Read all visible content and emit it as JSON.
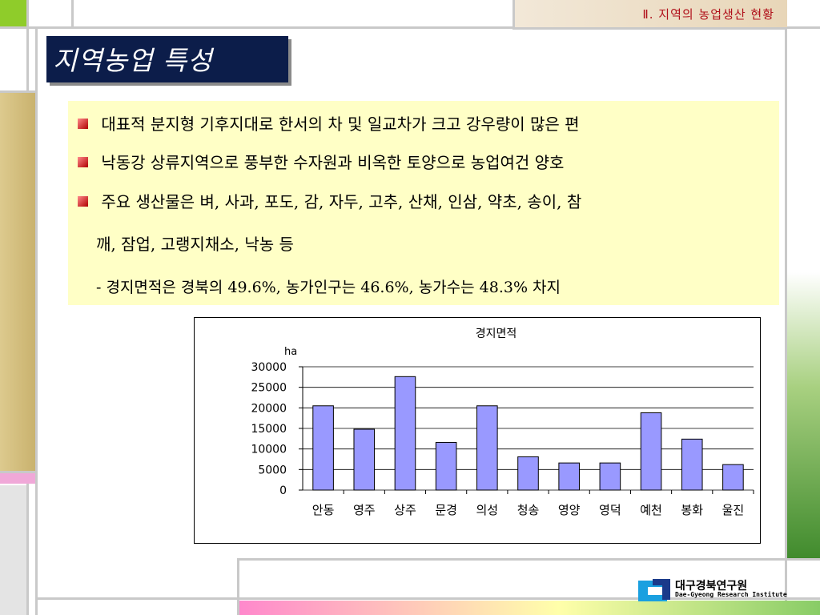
{
  "header": {
    "section_title": "Ⅱ. 지역의 농업생산 현황"
  },
  "slide": {
    "title": "지역농업 특성"
  },
  "bullets": [
    "대표적 분지형 기후지대로 한서의 차 및 일교차가 크고 강우량이 많은 편",
    "낙동강 상류지역으로 풍부한 수자원과 비옥한 토양으로 농업여건 양호",
    "주요 생산물은 벼, 사과, 포도, 감, 자두, 고추, 산채, 인삼, 약초, 송이, 참"
  ],
  "bullet_continuation": "깨, 잠업, 고랭지채소, 낙농 등",
  "sub_note": "- 경지면적은 경북의 49.6%, 농가인구는 46.6%, 농가수는 48.3% 차지",
  "chart_data": {
    "type": "bar",
    "title": "경지면적",
    "ylabel": "ha",
    "xlabel": "",
    "categories": [
      "안동",
      "영주",
      "상주",
      "문경",
      "의성",
      "청송",
      "영양",
      "영덕",
      "예천",
      "봉화",
      "울진"
    ],
    "values": [
      20500,
      14800,
      27600,
      11600,
      20500,
      8100,
      6600,
      6600,
      18800,
      12400,
      6200
    ],
    "ylim": [
      0,
      30000
    ],
    "yticks": [
      "30000",
      "25000",
      "20000",
      "15000",
      "10000",
      "5000",
      "0"
    ],
    "bar_color": "#9999ff",
    "grid": true
  },
  "footer": {
    "logo_korean": "대구경북연구원",
    "logo_english": "Dae-Gyeong Research Institute"
  },
  "colors": {
    "accent_red": "#b0101a",
    "title_bg": "#0c1d4a",
    "panel_bg": "#ffffc6",
    "bar_fill": "#9999ff",
    "left_tan": "#cdb777",
    "left_green": "#5a8d2c",
    "pink": "#f0a8d8"
  }
}
